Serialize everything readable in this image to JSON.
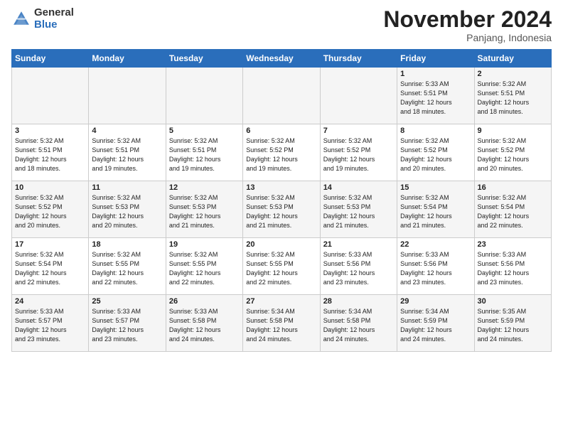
{
  "header": {
    "logo_general": "General",
    "logo_blue": "Blue",
    "month_title": "November 2024",
    "subtitle": "Panjang, Indonesia"
  },
  "weekdays": [
    "Sunday",
    "Monday",
    "Tuesday",
    "Wednesday",
    "Thursday",
    "Friday",
    "Saturday"
  ],
  "weeks": [
    [
      {
        "day": "",
        "info": ""
      },
      {
        "day": "",
        "info": ""
      },
      {
        "day": "",
        "info": ""
      },
      {
        "day": "",
        "info": ""
      },
      {
        "day": "",
        "info": ""
      },
      {
        "day": "1",
        "info": "Sunrise: 5:33 AM\nSunset: 5:51 PM\nDaylight: 12 hours\nand 18 minutes."
      },
      {
        "day": "2",
        "info": "Sunrise: 5:32 AM\nSunset: 5:51 PM\nDaylight: 12 hours\nand 18 minutes."
      }
    ],
    [
      {
        "day": "3",
        "info": "Sunrise: 5:32 AM\nSunset: 5:51 PM\nDaylight: 12 hours\nand 18 minutes."
      },
      {
        "day": "4",
        "info": "Sunrise: 5:32 AM\nSunset: 5:51 PM\nDaylight: 12 hours\nand 19 minutes."
      },
      {
        "day": "5",
        "info": "Sunrise: 5:32 AM\nSunset: 5:51 PM\nDaylight: 12 hours\nand 19 minutes."
      },
      {
        "day": "6",
        "info": "Sunrise: 5:32 AM\nSunset: 5:52 PM\nDaylight: 12 hours\nand 19 minutes."
      },
      {
        "day": "7",
        "info": "Sunrise: 5:32 AM\nSunset: 5:52 PM\nDaylight: 12 hours\nand 19 minutes."
      },
      {
        "day": "8",
        "info": "Sunrise: 5:32 AM\nSunset: 5:52 PM\nDaylight: 12 hours\nand 20 minutes."
      },
      {
        "day": "9",
        "info": "Sunrise: 5:32 AM\nSunset: 5:52 PM\nDaylight: 12 hours\nand 20 minutes."
      }
    ],
    [
      {
        "day": "10",
        "info": "Sunrise: 5:32 AM\nSunset: 5:52 PM\nDaylight: 12 hours\nand 20 minutes."
      },
      {
        "day": "11",
        "info": "Sunrise: 5:32 AM\nSunset: 5:53 PM\nDaylight: 12 hours\nand 20 minutes."
      },
      {
        "day": "12",
        "info": "Sunrise: 5:32 AM\nSunset: 5:53 PM\nDaylight: 12 hours\nand 21 minutes."
      },
      {
        "day": "13",
        "info": "Sunrise: 5:32 AM\nSunset: 5:53 PM\nDaylight: 12 hours\nand 21 minutes."
      },
      {
        "day": "14",
        "info": "Sunrise: 5:32 AM\nSunset: 5:53 PM\nDaylight: 12 hours\nand 21 minutes."
      },
      {
        "day": "15",
        "info": "Sunrise: 5:32 AM\nSunset: 5:54 PM\nDaylight: 12 hours\nand 21 minutes."
      },
      {
        "day": "16",
        "info": "Sunrise: 5:32 AM\nSunset: 5:54 PM\nDaylight: 12 hours\nand 22 minutes."
      }
    ],
    [
      {
        "day": "17",
        "info": "Sunrise: 5:32 AM\nSunset: 5:54 PM\nDaylight: 12 hours\nand 22 minutes."
      },
      {
        "day": "18",
        "info": "Sunrise: 5:32 AM\nSunset: 5:55 PM\nDaylight: 12 hours\nand 22 minutes."
      },
      {
        "day": "19",
        "info": "Sunrise: 5:32 AM\nSunset: 5:55 PM\nDaylight: 12 hours\nand 22 minutes."
      },
      {
        "day": "20",
        "info": "Sunrise: 5:32 AM\nSunset: 5:55 PM\nDaylight: 12 hours\nand 22 minutes."
      },
      {
        "day": "21",
        "info": "Sunrise: 5:33 AM\nSunset: 5:56 PM\nDaylight: 12 hours\nand 23 minutes."
      },
      {
        "day": "22",
        "info": "Sunrise: 5:33 AM\nSunset: 5:56 PM\nDaylight: 12 hours\nand 23 minutes."
      },
      {
        "day": "23",
        "info": "Sunrise: 5:33 AM\nSunset: 5:56 PM\nDaylight: 12 hours\nand 23 minutes."
      }
    ],
    [
      {
        "day": "24",
        "info": "Sunrise: 5:33 AM\nSunset: 5:57 PM\nDaylight: 12 hours\nand 23 minutes."
      },
      {
        "day": "25",
        "info": "Sunrise: 5:33 AM\nSunset: 5:57 PM\nDaylight: 12 hours\nand 23 minutes."
      },
      {
        "day": "26",
        "info": "Sunrise: 5:33 AM\nSunset: 5:58 PM\nDaylight: 12 hours\nand 24 minutes."
      },
      {
        "day": "27",
        "info": "Sunrise: 5:34 AM\nSunset: 5:58 PM\nDaylight: 12 hours\nand 24 minutes."
      },
      {
        "day": "28",
        "info": "Sunrise: 5:34 AM\nSunset: 5:58 PM\nDaylight: 12 hours\nand 24 minutes."
      },
      {
        "day": "29",
        "info": "Sunrise: 5:34 AM\nSunset: 5:59 PM\nDaylight: 12 hours\nand 24 minutes."
      },
      {
        "day": "30",
        "info": "Sunrise: 5:35 AM\nSunset: 5:59 PM\nDaylight: 12 hours\nand 24 minutes."
      }
    ]
  ]
}
